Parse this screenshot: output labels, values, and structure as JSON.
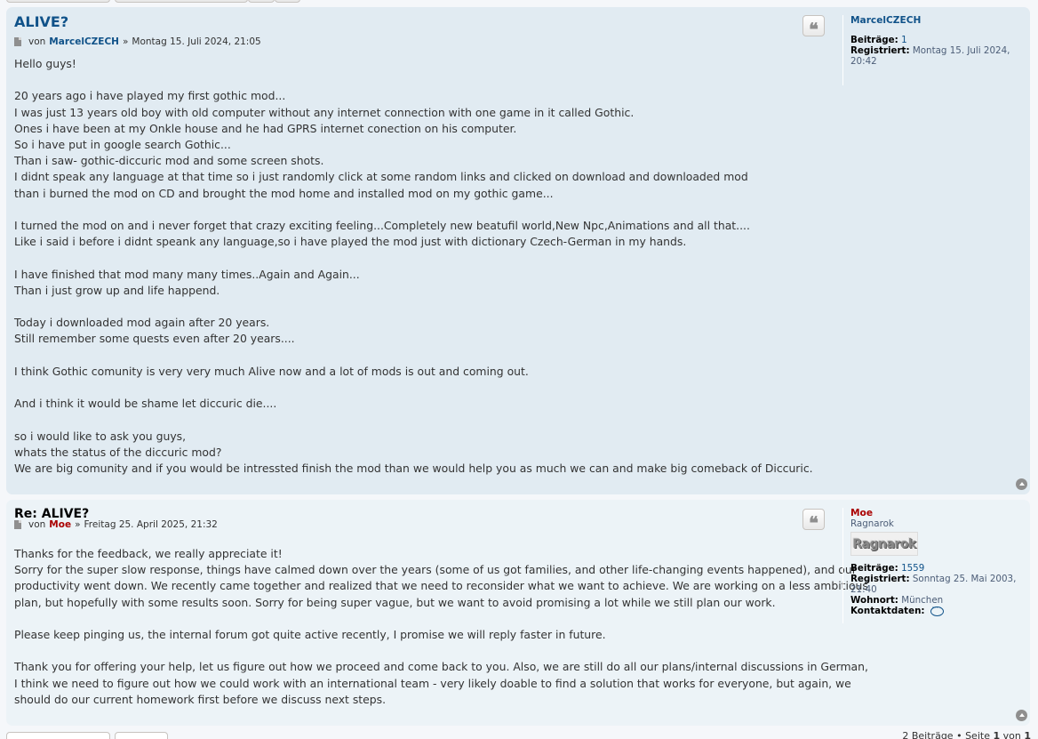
{
  "posts": [
    {
      "title": "ALIVE?",
      "by": "von",
      "author": "MarcelCZECH",
      "sep": "»",
      "date": "Montag 15. Juli 2024, 21:05",
      "quote_glyph": "❝",
      "content": [
        "Hello guys!",
        "",
        "20 years ago i have played my first gothic mod...",
        "I was just 13 years old boy with old computer without any internet connection with one game in it called Gothic.",
        "Ones i have been at my Onkle house and he had GPRS internet conection on his computer.",
        "So i have put in google search Gothic...",
        "Than i saw- gothic-diccuric mod and some screen shots.",
        "I didnt speak any language at that time so i just randomly click at some random links and clicked on download and downloaded mod",
        "than i burned the mod on CD and brought the mod home and installed mod on my gothic game...",
        "",
        "I turned the mod on and i never forget that crazy exciting feeling...Completely new beatufil world,New Npc,Animations and all that....",
        "Like i said i before i didnt speank any language,so i have played the mod just with dictionary Czech-German in my hands.",
        "",
        "I have finished that mod many many times..Again and Again...",
        "Than i just grow up and life happend.",
        "",
        "Today i downloaded mod again after 20 years.",
        "Still remember some quests even after 20 years....",
        "",
        "I think Gothic comunity is very very much Alive now and a lot of mods is out and coming out.",
        "",
        "And i think it would be shame let diccuric die....",
        "",
        "so i would like to ask you guys,",
        "whats the status of the diccuric mod?",
        "We are big comunity and if you would be intressted finish the mod than we would help you as much we can and make big comeback of Diccuric."
      ],
      "profile": {
        "name": "MarcelCZECH",
        "posts_label": "Beiträge:",
        "posts_value": "1",
        "registered_label": "Registriert:",
        "registered_value": "Montag 15. Juli 2024, 20:42"
      }
    },
    {
      "title": "Re: ALIVE?",
      "by": "von",
      "author": "Moe",
      "sep": "»",
      "date": "Freitag 25. April 2025, 21:32",
      "quote_glyph": "❝",
      "content": [
        "Thanks for the feedback, we really appreciate it!",
        "Sorry for the super slow response, things have calmed down over the years (some of us got families, and other life-changing events happened), and our",
        "productivity went down. We recently came together and realized that we need to reconsider what we want to achieve. We are working on a less ambitious",
        "plan, but hopefully with some results soon. Sorry for being super vague, but we want to avoid promising a lot while we still plan our work.",
        "",
        "Please keep pinging us, the internal forum got quite active recently, I promise we will reply faster in future.",
        "",
        "Thank you for offering your help, let us figure out how we proceed and come back to you. Also, we are still do all our plans/internal discussions in German,",
        "I think we need to figure out how we could work with an international team - very likely doable to find a solution that works for everyone, but again, we",
        "should do our current homework first before we discuss next steps."
      ],
      "profile": {
        "name": "Moe",
        "rank": "Ragnarok",
        "rank_image_text": "Ragnarok",
        "posts_label": "Beiträge:",
        "posts_value": "1559",
        "registered_label": "Registriert:",
        "registered_value": "Sonntag 25. Mai 2003, 21:40",
        "location_label": "Wohnort:",
        "location_value": "München",
        "contact_label": "Kontaktdaten:"
      }
    }
  ],
  "footer": {
    "count": "2 Beiträge",
    "bullet": "•",
    "page_label": "Seite",
    "page_current": "1",
    "of_label": "von",
    "page_total": "1"
  },
  "colors": {
    "post_bg_1": "#e1ebf2",
    "post_bg_2": "#ecf3f7",
    "link_blue": "#105289",
    "admin_red": "#aa0000"
  },
  "icons": [
    "post-doc-icon",
    "quote-icon",
    "back-to-top-icon",
    "contact-icon"
  ]
}
